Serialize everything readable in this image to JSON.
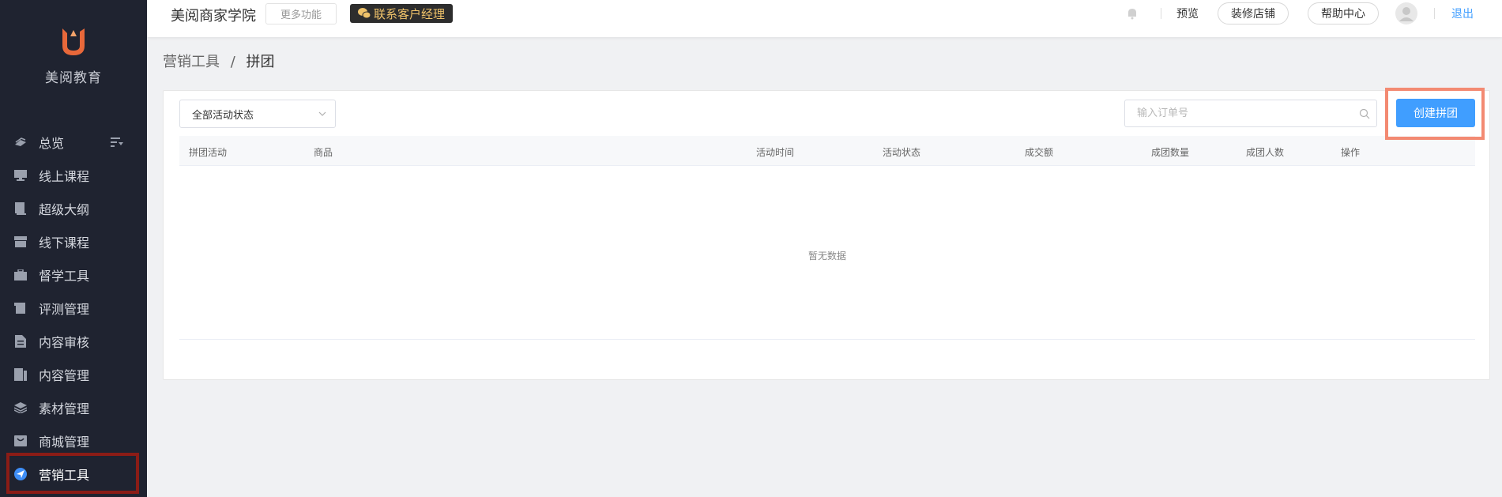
{
  "sidebar": {
    "logo_text": "美阅教育",
    "items": [
      {
        "label": "总览",
        "icon": "dashboard-icon"
      },
      {
        "label": "线上课程",
        "icon": "monitor-icon"
      },
      {
        "label": "超级大纲",
        "icon": "book-icon"
      },
      {
        "label": "线下课程",
        "icon": "store-icon"
      },
      {
        "label": "督学工具",
        "icon": "briefcase-icon"
      },
      {
        "label": "评测管理",
        "icon": "scroll-icon"
      },
      {
        "label": "内容审核",
        "icon": "document-icon"
      },
      {
        "label": "内容管理",
        "icon": "content-icon"
      },
      {
        "label": "素材管理",
        "icon": "layers-icon"
      },
      {
        "label": "商城管理",
        "icon": "mall-icon"
      },
      {
        "label": "营销工具",
        "icon": "paper-plane-icon"
      }
    ],
    "active_index": 10
  },
  "topbar": {
    "brand": "美阅商家学院",
    "more_label": "更多功能",
    "contact_label": "联系客户经理",
    "preview_label": "预览",
    "decorate_label": "装修店铺",
    "help_label": "帮助中心",
    "logout_label": "退出"
  },
  "breadcrumb": {
    "parent": "营销工具",
    "separator": "/",
    "current": "拼团"
  },
  "filters": {
    "status_select": "全部活动状态",
    "search_placeholder": "输入订单号",
    "create_label": "创建拼团"
  },
  "table": {
    "columns": [
      "拼团活动",
      "商品",
      "活动时间",
      "活动状态",
      "成交额",
      "成团数量",
      "成团人数",
      "操作"
    ],
    "empty_text": "暂无数据"
  },
  "colors": {
    "sidebar_bg": "#1f2330",
    "accent": "#409eff",
    "active_highlight": "#8b1c16",
    "button_highlight": "#f38a72",
    "logo_orange": "#e8683a"
  }
}
